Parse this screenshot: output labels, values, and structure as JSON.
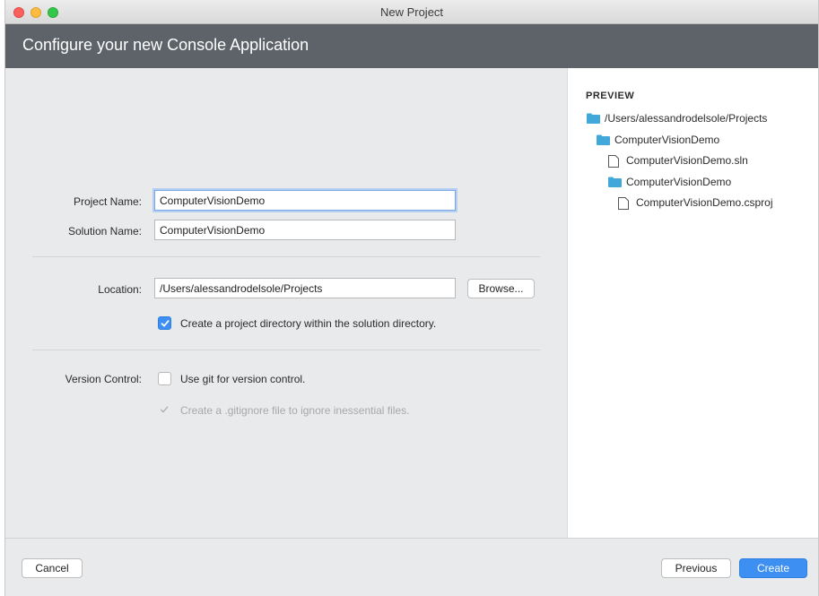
{
  "window": {
    "title": "New Project"
  },
  "header": {
    "title": "Configure your new Console Application"
  },
  "form": {
    "project_name": {
      "label": "Project Name:",
      "value": "ComputerVisionDemo"
    },
    "solution_name": {
      "label": "Solution Name:",
      "value": "ComputerVisionDemo"
    },
    "location": {
      "label": "Location:",
      "value": "/Users/alessandrodelsole/Projects",
      "browse_label": "Browse..."
    },
    "create_directory": {
      "label": "Create a project directory within the solution directory.",
      "checked": true
    },
    "version_control": {
      "label": "Version Control:",
      "use_git": {
        "label": "Use git for version control.",
        "checked": false
      },
      "gitignore": {
        "label": "Create a .gitignore file to ignore inessential files.",
        "checked": true,
        "disabled": true
      }
    }
  },
  "preview": {
    "heading": "PREVIEW",
    "items": [
      {
        "label": "/Users/alessandrodelsole/Projects",
        "icon": "folder-icon"
      },
      {
        "label": "ComputerVisionDemo",
        "icon": "folder-icon"
      },
      {
        "label": "ComputerVisionDemo.sln",
        "icon": "file-icon"
      },
      {
        "label": "ComputerVisionDemo",
        "icon": "folder-icon"
      },
      {
        "label": "ComputerVisionDemo.csproj",
        "icon": "file-icon"
      }
    ]
  },
  "footer": {
    "cancel_label": "Cancel",
    "previous_label": "Previous",
    "create_label": "Create"
  },
  "colors": {
    "accent": "#3d8ff2",
    "header_bg": "#5d6369",
    "folder": "#42a8d9"
  }
}
